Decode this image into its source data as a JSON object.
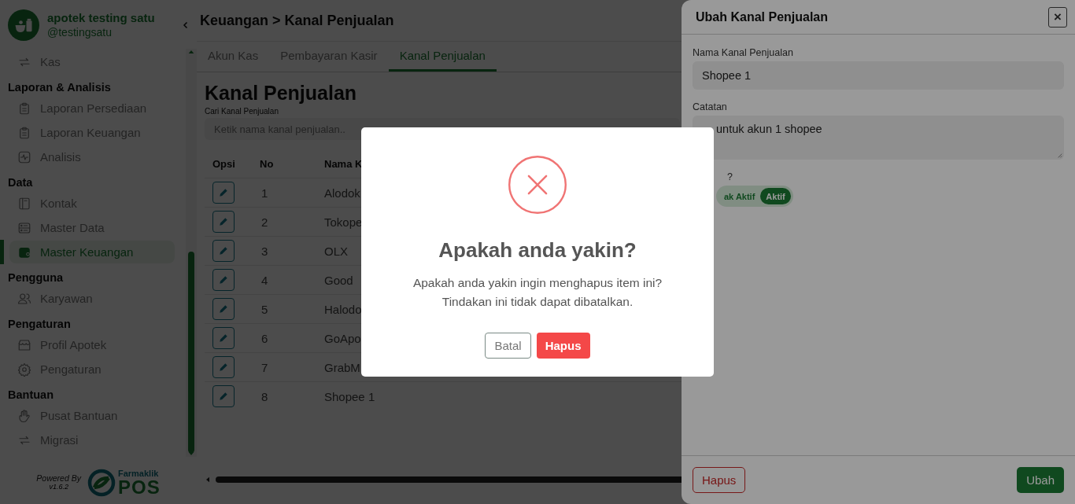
{
  "sidebar": {
    "store_name": "apotek testing satu",
    "handle": "@testingsatu",
    "items": [
      {
        "kind": "item",
        "label": "Kas",
        "selected": false
      },
      {
        "kind": "heading",
        "label": "Laporan & Analisis"
      },
      {
        "kind": "item",
        "label": "Laporan Persediaan",
        "selected": false
      },
      {
        "kind": "item",
        "label": "Laporan Keuangan",
        "selected": false
      },
      {
        "kind": "item",
        "label": "Analisis",
        "selected": false
      },
      {
        "kind": "heading",
        "label": "Data"
      },
      {
        "kind": "item",
        "label": "Kontak",
        "selected": false
      },
      {
        "kind": "item",
        "label": "Master Data",
        "selected": false
      },
      {
        "kind": "item",
        "label": "Master Keuangan",
        "selected": true
      },
      {
        "kind": "heading",
        "label": "Pengguna"
      },
      {
        "kind": "item",
        "label": "Karyawan",
        "selected": false
      },
      {
        "kind": "heading",
        "label": "Pengaturan"
      },
      {
        "kind": "item",
        "label": "Profil Apotek",
        "selected": false
      },
      {
        "kind": "item",
        "label": "Pengaturan",
        "selected": false
      },
      {
        "kind": "heading",
        "label": "Bantuan"
      },
      {
        "kind": "item",
        "label": "Pusat Bantuan",
        "selected": false
      },
      {
        "kind": "item",
        "label": "Migrasi",
        "selected": false
      }
    ],
    "powered_by": "Powered By",
    "version": "v1.6.2",
    "brand_name": "Farmaklik",
    "brand_product": "POS"
  },
  "main": {
    "breadcrumb": "Keuangan > Kanal Penjualan",
    "tabs": [
      {
        "label": "Akun Kas",
        "selected": false
      },
      {
        "label": "Pembayaran Kasir",
        "selected": false
      },
      {
        "label": "Kanal Penjualan",
        "selected": true
      }
    ],
    "title": "Kanal Penjualan",
    "search": {
      "label": "Cari Kanal Penjualan",
      "placeholder": "Ketik nama kanal penjualan.."
    },
    "table": {
      "columns": [
        "Opsi",
        "No",
        "Nama K"
      ],
      "rows": [
        {
          "no": "1",
          "name": "Alodok"
        },
        {
          "no": "2",
          "name": "Tokope"
        },
        {
          "no": "3",
          "name": "OLX"
        },
        {
          "no": "4",
          "name": "Good"
        },
        {
          "no": "5",
          "name": "Halodo"
        },
        {
          "no": "6",
          "name": "GoApo"
        },
        {
          "no": "7",
          "name": "GrabM"
        },
        {
          "no": "8",
          "name": "Shopee 1"
        }
      ]
    }
  },
  "drawer": {
    "title": "Ubah Kanal Penjualan",
    "close": "×",
    "fields": [
      {
        "label": "Nama Kanal Penjualan",
        "value": "Shopee 1",
        "kind": "input"
      },
      {
        "label": "Catatan",
        "value": "untuk akun 1 shopee",
        "kind": "textarea"
      }
    ],
    "status_label": "?",
    "status_options": [
      {
        "label": "ak Aktif",
        "selected": false
      },
      {
        "label": "Aktif",
        "selected": true
      }
    ],
    "buttons": [
      {
        "label": "Hapus",
        "kind": "danger"
      },
      {
        "label": "Ubah",
        "kind": "primary"
      }
    ]
  },
  "modal": {
    "title": "Apakah anda yakin?",
    "message": [
      "Apakah anda yakin ingin menghapus item ini?",
      "Tindakan ini tidak dapat dibatalkan."
    ],
    "buttons": [
      {
        "label": "Batal",
        "kind": "secondary"
      },
      {
        "label": "Hapus",
        "kind": "danger"
      }
    ]
  }
}
